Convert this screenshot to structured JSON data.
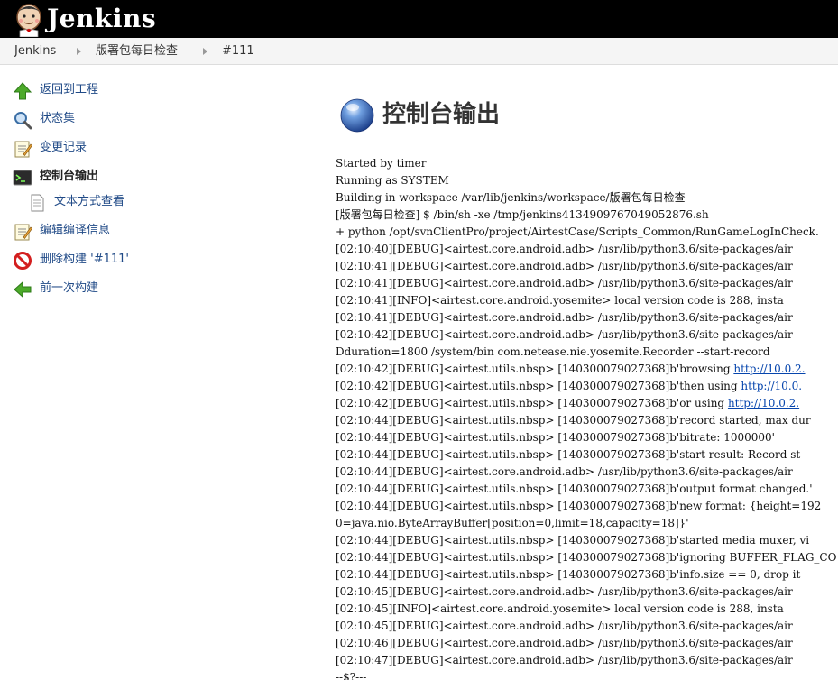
{
  "header": {
    "brand": "Jenkins",
    "logo_icon": "jenkins-butler-icon"
  },
  "breadcrumb": {
    "items": [
      "Jenkins",
      "版署包每日检查",
      "#111"
    ]
  },
  "sidebar": {
    "items": [
      {
        "label": "返回到工程",
        "icon": "up-arrow-icon"
      },
      {
        "label": "状态集",
        "icon": "magnifier-icon"
      },
      {
        "label": "变更记录",
        "icon": "notepad-icon"
      },
      {
        "label": "控制台输出",
        "icon": "terminal-icon",
        "selected": true
      },
      {
        "label": "文本方式查看",
        "icon": "document-icon",
        "sub": true
      },
      {
        "label": "编辑编译信息",
        "icon": "notepad-icon"
      },
      {
        "label": "删除构建 '#111'",
        "icon": "no-entry-icon"
      },
      {
        "label": "前一次构建",
        "icon": "left-arrow-icon"
      }
    ]
  },
  "main": {
    "title": "控制台输出",
    "title_icon": "blue-orb-icon",
    "console_lines": [
      {
        "text": "Started by timer"
      },
      {
        "text": "Running as SYSTEM"
      },
      {
        "text": "Building in workspace /var/lib/jenkins/workspace/版署包每日检查"
      },
      {
        "text": "[版署包每日检查] $ /bin/sh -xe /tmp/jenkins4134909767049052876.sh"
      },
      {
        "text": "+ python /opt/svnClientPro/project/AirtestCase/Scripts_Common/RunGameLogInCheck."
      },
      {
        "text": "[02:10:40][DEBUG]<airtest.core.android.adb> /usr/lib/python3.6/site-packages/air"
      },
      {
        "text": "[02:10:41][DEBUG]<airtest.core.android.adb> /usr/lib/python3.6/site-packages/air"
      },
      {
        "text": "[02:10:41][DEBUG]<airtest.core.android.adb> /usr/lib/python3.6/site-packages/air"
      },
      {
        "text": "[02:10:41][INFO]<airtest.core.android.yosemite> local version code is 288, insta"
      },
      {
        "text": "[02:10:41][DEBUG]<airtest.core.android.adb> /usr/lib/python3.6/site-packages/air"
      },
      {
        "text": "[02:10:42][DEBUG]<airtest.core.android.adb> /usr/lib/python3.6/site-packages/air"
      },
      {
        "text": "Dduration=1800 /system/bin com.netease.nie.yosemite.Recorder --start-record"
      },
      {
        "text": "[02:10:42][DEBUG]<airtest.utils.nbsp> [140300079027368]b'browsing ",
        "link": "http://10.0.2."
      },
      {
        "text": "[02:10:42][DEBUG]<airtest.utils.nbsp> [140300079027368]b'then using ",
        "link": "http://10.0."
      },
      {
        "text": "[02:10:42][DEBUG]<airtest.utils.nbsp> [140300079027368]b'or using ",
        "link": "http://10.0.2."
      },
      {
        "text": "[02:10:44][DEBUG]<airtest.utils.nbsp> [140300079027368]b'record started, max dur"
      },
      {
        "text": "[02:10:44][DEBUG]<airtest.utils.nbsp> [140300079027368]b'bitrate: 1000000'"
      },
      {
        "text": "[02:10:44][DEBUG]<airtest.utils.nbsp> [140300079027368]b'start result: Record st"
      },
      {
        "text": "[02:10:44][DEBUG]<airtest.core.android.adb> /usr/lib/python3.6/site-packages/air"
      },
      {
        "text": "[02:10:44][DEBUG]<airtest.utils.nbsp> [140300079027368]b'output format changed.'"
      },
      {
        "text": "[02:10:44][DEBUG]<airtest.utils.nbsp> [140300079027368]b'new format: {height=192"
      },
      {
        "text": "0=java.nio.ByteArrayBuffer[position=0,limit=18,capacity=18]}'"
      },
      {
        "text": "[02:10:44][DEBUG]<airtest.utils.nbsp> [140300079027368]b'started media muxer, vi"
      },
      {
        "text": "[02:10:44][DEBUG]<airtest.utils.nbsp> [140300079027368]b'ignoring BUFFER_FLAG_CO"
      },
      {
        "text": "[02:10:44][DEBUG]<airtest.utils.nbsp> [140300079027368]b'info.size == 0, drop it"
      },
      {
        "text": "[02:10:45][DEBUG]<airtest.core.android.adb> /usr/lib/python3.6/site-packages/air"
      },
      {
        "text": "[02:10:45][INFO]<airtest.core.android.yosemite> local version code is 288, insta"
      },
      {
        "text": "[02:10:45][DEBUG]<airtest.core.android.adb> /usr/lib/python3.6/site-packages/air"
      },
      {
        "text": "[02:10:46][DEBUG]<airtest.core.android.adb> /usr/lib/python3.6/site-packages/air"
      },
      {
        "text": "[02:10:47][DEBUG]<airtest.core.android.adb> /usr/lib/python3.6/site-packages/air"
      },
      {
        "text": "--$?---"
      }
    ]
  },
  "colors": {
    "header_bg": "#000000",
    "breadcrumb_bg": "#f5f5f5",
    "link": "#0645ad",
    "task_link": "#204a87"
  }
}
